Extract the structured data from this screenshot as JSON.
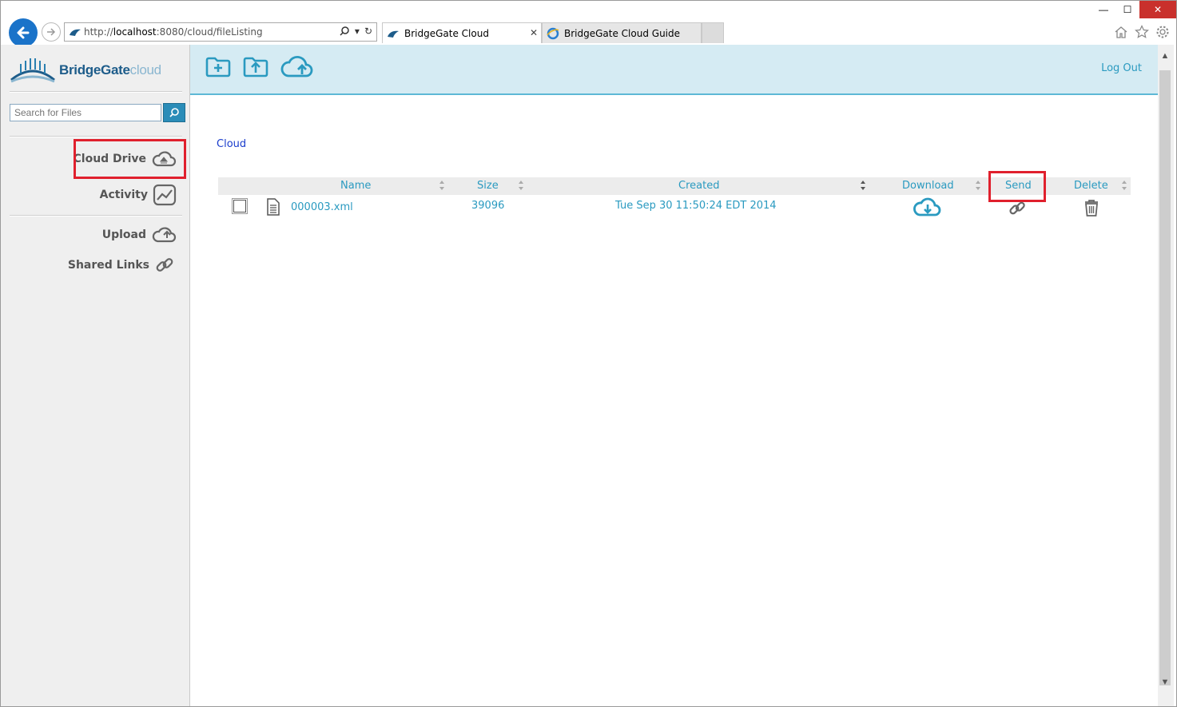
{
  "browser": {
    "url_prefix": "http://",
    "url_host": "localhost",
    "url_rest": ":8080/cloud/fileListing",
    "tabs": [
      {
        "label": "BridgeGate Cloud",
        "active": true
      },
      {
        "label": "BridgeGate Cloud Guide",
        "active": false
      }
    ],
    "window_controls": {
      "minimize": "—",
      "maximize": "☐",
      "close": "✕"
    }
  },
  "sidebar": {
    "logo_bold": "BridgeGate",
    "logo_light": "cloud",
    "search_placeholder": "Search for Files",
    "nav": [
      {
        "label": "Cloud Drive",
        "icon": "cloud-drive-icon",
        "highlighted": true
      },
      {
        "label": "Activity",
        "icon": "activity-chart-icon"
      },
      {
        "label": "Upload",
        "icon": "cloud-upload-icon"
      },
      {
        "label": "Shared Links",
        "icon": "link-icon"
      }
    ]
  },
  "topbar": {
    "icons": [
      "new-folder-icon",
      "folder-upload-icon",
      "cloud-upload-icon"
    ],
    "logout_label": "Log Out"
  },
  "breadcrumb": "Cloud",
  "table": {
    "columns": [
      "Name",
      "Size",
      "Created",
      "Download",
      "Send",
      "Delete"
    ],
    "rows": [
      {
        "name": "000003.xml",
        "size": "39096",
        "created": "Tue Sep 30 11:50:24 EDT 2014"
      }
    ]
  },
  "colors": {
    "accent": "#2a9ac0",
    "highlight": "#e0202d",
    "topbar": "#d5ebf3"
  }
}
